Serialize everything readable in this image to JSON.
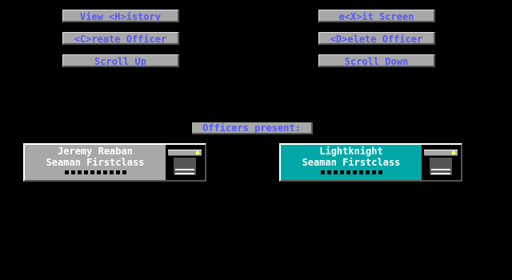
{
  "buttons": {
    "view_history": "View <H>istory",
    "create_officer": "<C>reate Officer",
    "scroll_up": "Scroll Up",
    "exit_screen": "e<X>it Screen",
    "delete_officer": "<D>elete Officer",
    "scroll_down": "Scroll Down"
  },
  "officers_present_label": "Officers present:",
  "officers": [
    {
      "name": "Jeremy Reaban",
      "rank": "Seaman Firstclass",
      "rank_pips": 10,
      "card_color": "#a8a8a8",
      "icon": "locker-icon"
    },
    {
      "name": "Lightknight",
      "rank": "Seaman Firstclass",
      "rank_pips": 10,
      "card_color": "#00a8a8",
      "icon": "locker-icon"
    }
  ],
  "colors": {
    "background": "#000000",
    "button_face": "#a8a8a8",
    "button_text": "#5555ff",
    "selected_card": "#00a8a8"
  }
}
